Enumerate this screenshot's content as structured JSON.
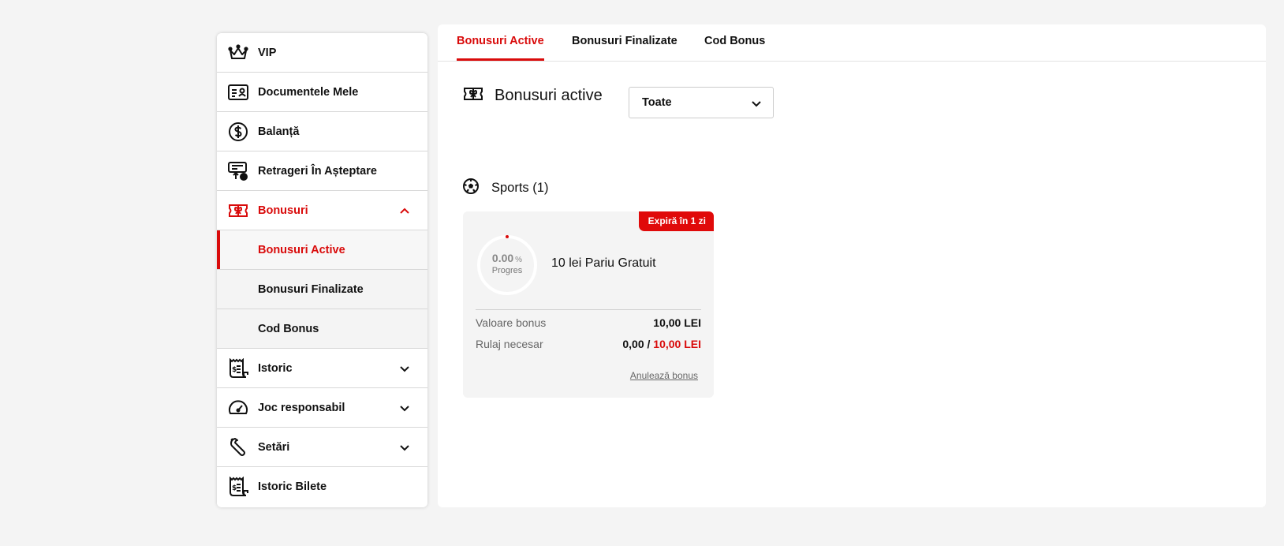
{
  "sidebar": {
    "items": [
      {
        "label": "VIP",
        "icon": "crown-icon"
      },
      {
        "label": "Documentele Mele",
        "icon": "id-card-icon"
      },
      {
        "label": "Balanță",
        "icon": "dollar-circle-icon"
      },
      {
        "label": "Retrageri În Așteptare",
        "icon": "pending-withdrawal-icon"
      },
      {
        "label": "Bonusuri",
        "icon": "gift-ticket-icon",
        "expanded": true,
        "children": [
          {
            "label": "Bonusuri Active",
            "active": true
          },
          {
            "label": "Bonusuri Finalizate"
          },
          {
            "label": "Cod Bonus"
          }
        ]
      },
      {
        "label": "Istoric",
        "icon": "receipt-icon"
      },
      {
        "label": "Joc responsabil",
        "icon": "gauge-icon"
      },
      {
        "label": "Setări",
        "icon": "wrench-icon"
      },
      {
        "label": "Istoric Bilete",
        "icon": "receipt-icon"
      }
    ]
  },
  "tabs": [
    {
      "label": "Bonusuri Active",
      "active": true
    },
    {
      "label": "Bonusuri Finalizate"
    },
    {
      "label": "Cod Bonus"
    }
  ],
  "section": {
    "title": "Bonusuri active",
    "filter_value": "Toate"
  },
  "category": {
    "title": "Sports (1)"
  },
  "bonus_card": {
    "expire_badge": "Expiră în 1 zi",
    "progress_value": "0.00",
    "progress_unit": "%",
    "progress_label": "Progres",
    "name": "10 lei Pariu Gratuit",
    "value_label": "Valoare bonus",
    "value": "10,00 LEI",
    "wager_label": "Rulaj necesar",
    "wager_current": "0,00",
    "wager_separator": " / ",
    "wager_required": "10,00 LEI",
    "cancel_label": "Anulează bonus"
  },
  "colors": {
    "accent": "#d90b0b",
    "badge": "#e00a0a",
    "background": "#f4f4f4"
  }
}
